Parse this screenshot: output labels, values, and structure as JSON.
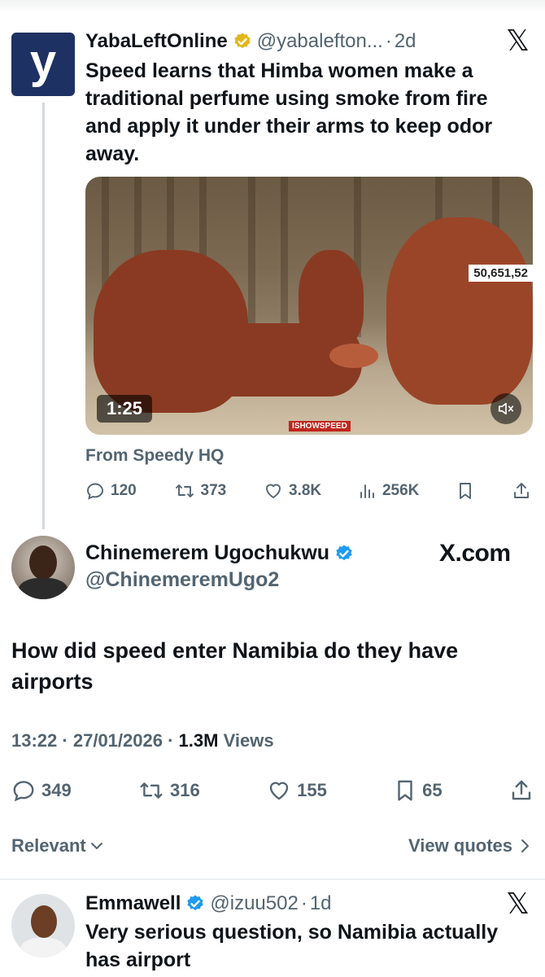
{
  "parent_tweet": {
    "avatar_letter": "y",
    "display_name": "YabaLeftOnline",
    "handle": "@yabalefton...",
    "separator": "·",
    "age": "2d",
    "text": "Speed learns that Himba women make a traditional perfume using smoke from fire and apply it under their arms to keep odor away.",
    "media": {
      "view_counter": "50,651,52",
      "duration": "1:25",
      "watermark": "ISHOWSPEED"
    },
    "source_label": "From Speedy HQ",
    "actions": {
      "replies": "120",
      "reposts": "373",
      "likes": "3.8K",
      "views": "256K"
    }
  },
  "main_tweet": {
    "display_name": "Chinemerem Ugochukwu",
    "handle": "@ChinemeremUgo2",
    "watermark": "X.com",
    "text": "How did speed enter Namibia do they have airports",
    "time": "13:22",
    "dot": "·",
    "date": "27/01/2026",
    "views_count": "1.3M",
    "views_label": "Views",
    "actions": {
      "replies": "349",
      "reposts": "316",
      "likes": "155",
      "bookmarks": "65"
    },
    "sort_label": "Relevant",
    "view_quotes_label": "View quotes"
  },
  "reply_tweet": {
    "display_name": "Emmawell",
    "handle": "@izuu502",
    "separator": "·",
    "age": "1d",
    "text": "Very serious question, so Namibia actually has airport"
  },
  "colors": {
    "text_primary": "#0f1419",
    "text_muted": "#536471",
    "verified_blue": "#1d9bf0",
    "verified_gold": "#e2b719",
    "brand_navy": "#1d3163"
  },
  "icons": [
    "x-logo-icon",
    "verified-gold-icon",
    "verified-blue-icon",
    "reply-icon",
    "repost-icon",
    "like-icon",
    "views-icon",
    "bookmark-icon",
    "share-icon",
    "mute-icon",
    "chevron-down-icon",
    "chevron-right-icon"
  ]
}
